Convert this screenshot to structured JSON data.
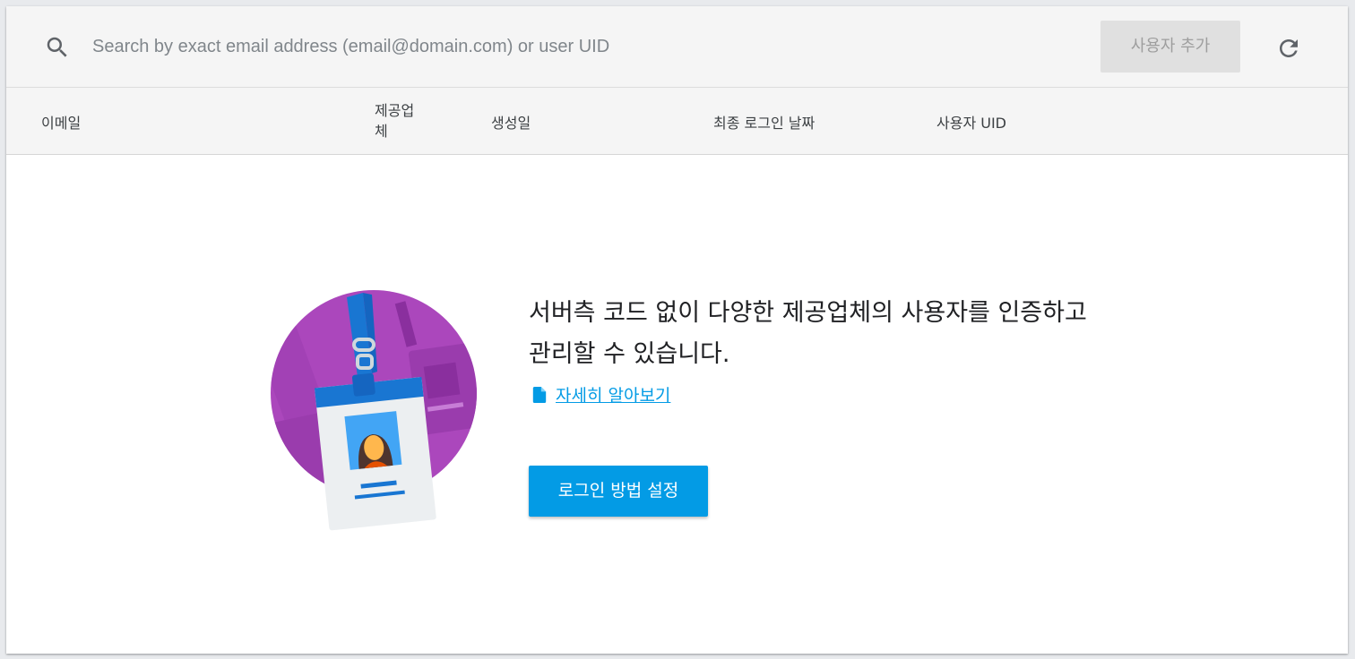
{
  "search": {
    "placeholder": "Search by exact email address (email@domain.com) or user UID",
    "icon": "search-icon"
  },
  "toolbar": {
    "add_user_label": "사용자 추가",
    "refresh_icon": "refresh-icon"
  },
  "table": {
    "columns": [
      "이메일",
      "제공업체",
      "생성일",
      "최종 로그인 날짜",
      "사용자 UID"
    ]
  },
  "empty_state": {
    "message": "서버측 코드 없이 다양한 제공업체의 사용자를 인증하고 관리할 수 있습니다.",
    "learn_more_label": "자세히 알아보기",
    "setup_button_label": "로그인 방법 설정",
    "illustration": "id-badge-illustration"
  },
  "colors": {
    "accent": "#039be5",
    "header_bg": "#f5f5f5",
    "illustration_purple": "#ab47bc"
  }
}
